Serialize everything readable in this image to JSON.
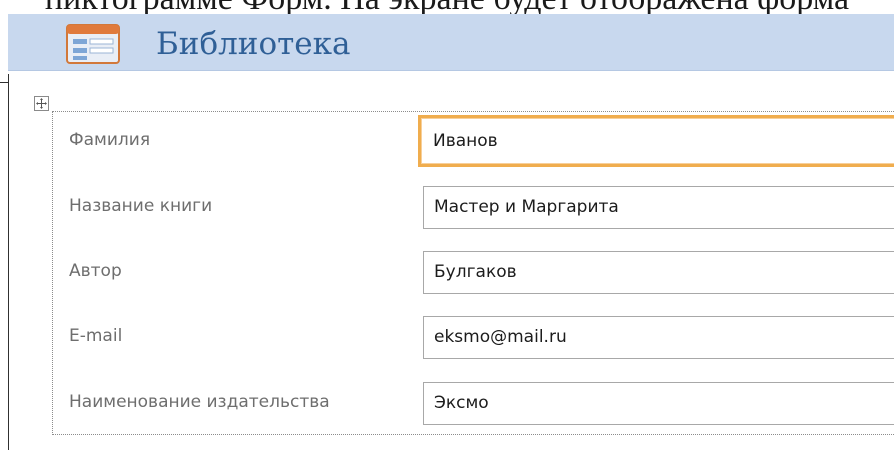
{
  "background_text": "пиктограмме Форм. На экране будет отображена форма",
  "header": {
    "title": "Библиотека",
    "icon": "form-icon",
    "background_color": "#c8d8ee",
    "title_color": "#2f5f96"
  },
  "layout": {
    "selector_icon": "move-cross-icon"
  },
  "fields": [
    {
      "label": "Фамилия",
      "value": "Иванов",
      "focused": true
    },
    {
      "label": "Название книги",
      "value": "Мастер и Маргарита",
      "focused": false
    },
    {
      "label": "Автор",
      "value": "Булгаков",
      "focused": false
    },
    {
      "label": "E-mail",
      "value": "eksmo@mail.ru",
      "focused": false
    },
    {
      "label": "Наименование издательства",
      "value": "Эксмо",
      "focused": false
    }
  ],
  "colors": {
    "focus_border": "#f0ad4e",
    "label_text": "#6e6e6e"
  }
}
